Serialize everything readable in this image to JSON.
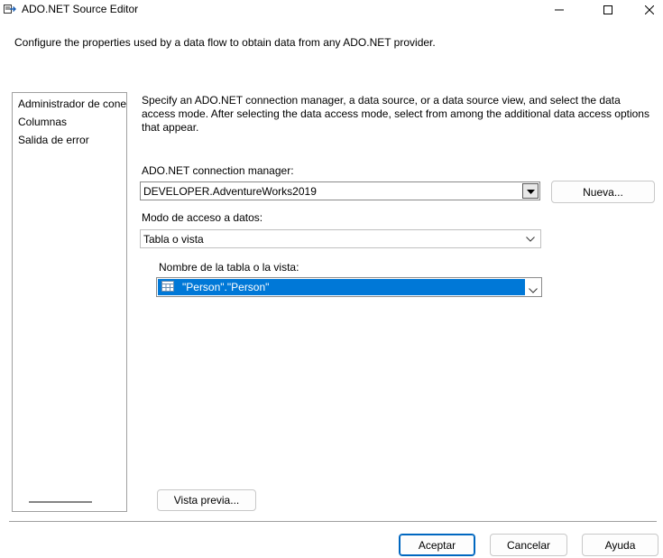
{
  "window": {
    "title": "ADO.NET Source Editor",
    "icons": [
      "app-icon",
      "minimize-icon",
      "maximize-icon",
      "close-icon"
    ]
  },
  "intro": "Configure the properties used by a data flow to obtain data from any ADO.NET provider.",
  "nav": {
    "items": [
      "Administrador de conexiones",
      "Columnas",
      "Salida de error"
    ]
  },
  "main": {
    "description": "Specify an ADO.NET connection manager, a data source, or a data source view, and select the data access mode. After selecting the data access mode, select from among the additional data access options that appear.",
    "connection_label": "ADO.NET connection manager:",
    "connection_value": "DEVELOPER.AdventureWorks2019",
    "new_button": "Nueva...",
    "access_mode_label": "Modo de acceso a datos:",
    "access_mode_value": "Tabla o vista",
    "table_label": "Nombre de la tabla o la vista:",
    "table_value": "\"Person\".\"Person\"",
    "preview_button": "Vista previa..."
  },
  "footer": {
    "ok": "Aceptar",
    "cancel": "Cancelar",
    "help": "Ayuda"
  },
  "colors": {
    "selection": "#0078d7",
    "default_button_border": "#0067c0"
  }
}
